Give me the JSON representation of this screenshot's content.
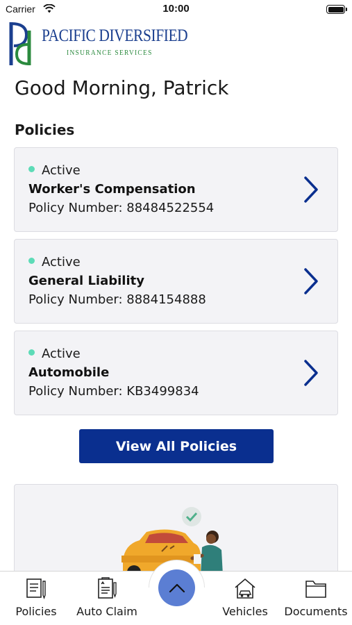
{
  "status_bar": {
    "carrier": "Carrier",
    "time": "10:00"
  },
  "logo": {
    "name": "PACIFIC DIVERSIFIED",
    "subtitle": "INSURANCE SERVICES"
  },
  "greeting": "Good Morning, Patrick",
  "policies_section": {
    "title": "Policies",
    "items": [
      {
        "status": "Active",
        "name": "Worker's Compensation",
        "number_label": "Policy Number: 88484522554"
      },
      {
        "status": "Active",
        "name": "General Liability",
        "number_label": "Policy Number: 8884154888"
      },
      {
        "status": "Active",
        "name": "Automobile",
        "number_label": "Policy Number: KB3499834"
      }
    ],
    "view_all_label": "View All Policies"
  },
  "colors": {
    "accent": "#0a2f8f",
    "active_dot": "#5ddbb7",
    "chevron": "#0a2f8f",
    "fab": "#5b7ed3"
  },
  "tab_bar": {
    "tabs": [
      {
        "label": "Policies",
        "icon": "document-pen-icon"
      },
      {
        "label": "Auto Claim",
        "icon": "claim-form-icon"
      },
      {
        "label": "Vehicles",
        "icon": "house-car-icon"
      },
      {
        "label": "Documents",
        "icon": "folder-icon"
      }
    ],
    "center_icon": "chevron-up-icon"
  }
}
